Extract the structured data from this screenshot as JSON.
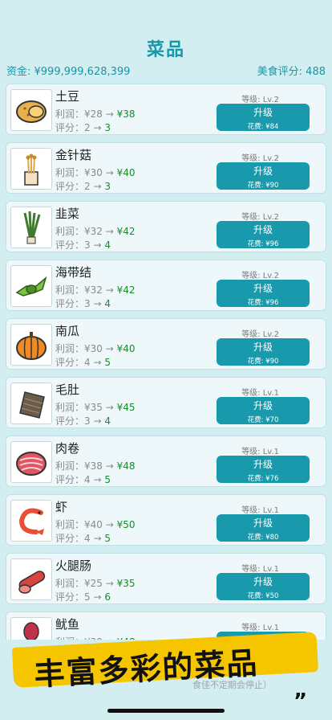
{
  "header": {
    "title": "菜品"
  },
  "stats": {
    "funds": "资金: ¥999,999,628,399",
    "rating": "美食评分: 488"
  },
  "labels": {
    "upgrade": "升级"
  },
  "dishes": [
    {
      "name": "土豆",
      "icon": "potato-icon",
      "level": "等级: Lv.2",
      "profit_old": "利润：¥28 → ",
      "profit_new": "¥38",
      "rating_old": "评分：2 → ",
      "rating_new": "3",
      "cost": "花费: ¥84"
    },
    {
      "name": "金针菇",
      "icon": "enoki-mushroom-icon",
      "level": "等级: Lv.2",
      "profit_old": "利润：¥30 → ",
      "profit_new": "¥40",
      "rating_old": "评分：2 → ",
      "rating_new": "3",
      "cost": "花费: ¥90"
    },
    {
      "name": "韭菜",
      "icon": "chives-icon",
      "level": "等级: Lv.2",
      "profit_old": "利润：¥32 → ",
      "profit_new": "¥42",
      "rating_old": "评分：3 → ",
      "rating_new": "4",
      "cost": "花费: ¥96"
    },
    {
      "name": "海带结",
      "icon": "kelp-knot-icon",
      "level": "等级: Lv.2",
      "profit_old": "利润：¥32 → ",
      "profit_new": "¥42",
      "rating_old": "评分：3 → ",
      "rating_new": "4",
      "cost": "花费: ¥96"
    },
    {
      "name": "南瓜",
      "icon": "pumpkin-icon",
      "level": "等级: Lv.2",
      "profit_old": "利润：¥30 → ",
      "profit_new": "¥40",
      "rating_old": "评分：4 → ",
      "rating_new": "5",
      "cost": "花费: ¥90"
    },
    {
      "name": "毛肚",
      "icon": "tripe-icon",
      "level": "等级: Lv.1",
      "profit_old": "利润：¥35 → ",
      "profit_new": "¥45",
      "rating_old": "评分：3 → ",
      "rating_new": "4",
      "cost": "花费: ¥70"
    },
    {
      "name": "肉卷",
      "icon": "meat-roll-icon",
      "level": "等级: Lv.1",
      "profit_old": "利润：¥38 → ",
      "profit_new": "¥48",
      "rating_old": "评分：4 → ",
      "rating_new": "5",
      "cost": "花费: ¥76"
    },
    {
      "name": "虾",
      "icon": "shrimp-icon",
      "level": "等级: Lv.1",
      "profit_old": "利润：¥40 → ",
      "profit_new": "¥50",
      "rating_old": "评分：4 → ",
      "rating_new": "5",
      "cost": "花费: ¥80"
    },
    {
      "name": "火腿肠",
      "icon": "ham-sausage-icon",
      "level": "等级: Lv.1",
      "profit_old": "利润：¥25 → ",
      "profit_new": "¥35",
      "rating_old": "评分：5 → ",
      "rating_new": "6",
      "cost": "花费: ¥50"
    },
    {
      "name": "鱿鱼",
      "icon": "squid-icon",
      "level": "等级: Lv.1",
      "profit_old": "利润：¥38 → ",
      "profit_new": "¥48",
      "rating_old": "评分：",
      "rating_new": "",
      "cost": ""
    }
  ],
  "footer": {
    "note": "食佳不定期会停止）",
    "banner": "丰富多彩的菜品",
    "quote": "”"
  },
  "colors": {
    "accent": "#1899ac",
    "title": "#1797a8",
    "positive": "#178c2b",
    "banner": "#f5c500",
    "background": "#d3eef0"
  }
}
